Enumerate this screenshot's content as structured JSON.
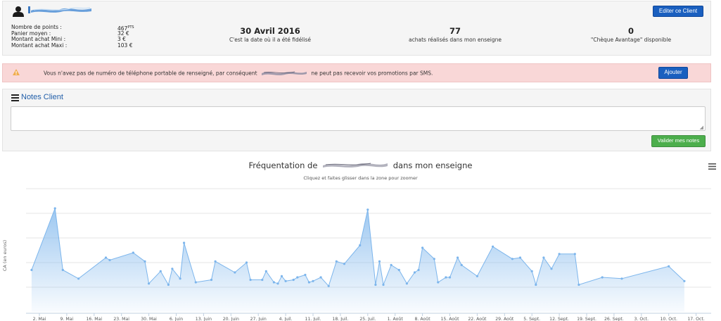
{
  "header": {
    "edit_button": "Editer ce Client",
    "stats": [
      {
        "label": "Nombre de points :",
        "value": "467",
        "unit": "PTS"
      },
      {
        "label": "Panier moyen :",
        "value": "32 €",
        "unit": ""
      },
      {
        "label": "Montant achat Mini :",
        "value": "3 €",
        "unit": ""
      },
      {
        "label": "Montant achat Maxi :",
        "value": "103 €",
        "unit": ""
      }
    ],
    "kpis": {
      "date": {
        "value": "30 Avril 2016",
        "caption": "C'est la date où il a été fidélisé"
      },
      "purchases": {
        "value": "77",
        "caption": "achats réalisés dans mon enseigne"
      },
      "cheque": {
        "value": "0",
        "caption": "\"Chèque Avantage\" disponible"
      }
    }
  },
  "alert": {
    "text_before": "Vous n'avez pas de numéro de téléphone portable de renseigné, par conséquent",
    "text_after": "ne peut pas recevoir vos promotions par SMS.",
    "button": "Ajouter"
  },
  "notes": {
    "title": "Notes Client",
    "value": "",
    "validate_button": "Valider mes notes"
  },
  "chart": {
    "title_before": "Fréquentation de",
    "title_after": "dans mon enseigne",
    "subtitle": "Cliquez et faites glisser dans la zone pour zoomer"
  },
  "chart_data": {
    "type": "area",
    "title": "Fréquentation de … dans mon enseigne",
    "subtitle": "Cliquez et faites glisser dans la zone pour zoomer",
    "xlabel": "",
    "ylabel": "CA (en euros)",
    "grid": true,
    "color": "#7cb5ec",
    "x_tick_labels": [
      "2. Mai",
      "9. Mai",
      "16. Mai",
      "23. Mai",
      "30. Mai",
      "6. Juin",
      "13. Juin",
      "20. Juin",
      "27. Juin",
      "4. Juil.",
      "11. Juil.",
      "18. Juil.",
      "25. Juil.",
      "1. Août",
      "8. Août",
      "15. Août",
      "22. Août",
      "29. Août",
      "5. Sept.",
      "12. Sept.",
      "19. Sept.",
      "26. Sept.",
      "3. Oct.",
      "10. Oct.",
      "17. Oct."
    ],
    "ylim": [
      0,
      5
    ],
    "points": [
      {
        "day": 0,
        "y": 1.7
      },
      {
        "day": 6,
        "y": 4.2
      },
      {
        "day": 8,
        "y": 1.7
      },
      {
        "day": 12,
        "y": 1.35
      },
      {
        "day": 19,
        "y": 2.2
      },
      {
        "day": 20,
        "y": 2.1
      },
      {
        "day": 26,
        "y": 2.4
      },
      {
        "day": 29,
        "y": 2.05
      },
      {
        "day": 30,
        "y": 1.15
      },
      {
        "day": 33,
        "y": 1.65
      },
      {
        "day": 35,
        "y": 1.1
      },
      {
        "day": 36,
        "y": 1.75
      },
      {
        "day": 38,
        "y": 1.35
      },
      {
        "day": 39,
        "y": 2.8
      },
      {
        "day": 42,
        "y": 1.2
      },
      {
        "day": 46,
        "y": 1.3
      },
      {
        "day": 47,
        "y": 2.05
      },
      {
        "day": 52,
        "y": 1.6
      },
      {
        "day": 55,
        "y": 2.0
      },
      {
        "day": 56,
        "y": 1.3
      },
      {
        "day": 59,
        "y": 1.3
      },
      {
        "day": 60,
        "y": 1.65
      },
      {
        "day": 62,
        "y": 1.2
      },
      {
        "day": 63,
        "y": 1.15
      },
      {
        "day": 64,
        "y": 1.45
      },
      {
        "day": 65,
        "y": 1.25
      },
      {
        "day": 67,
        "y": 1.3
      },
      {
        "day": 68,
        "y": 1.4
      },
      {
        "day": 70,
        "y": 1.5
      },
      {
        "day": 71,
        "y": 1.2
      },
      {
        "day": 72,
        "y": 1.25
      },
      {
        "day": 74,
        "y": 1.4
      },
      {
        "day": 76,
        "y": 1.05
      },
      {
        "day": 78,
        "y": 2.05
      },
      {
        "day": 80,
        "y": 1.95
      },
      {
        "day": 84,
        "y": 2.7
      },
      {
        "day": 86,
        "y": 4.15
      },
      {
        "day": 88,
        "y": 1.1
      },
      {
        "day": 89,
        "y": 2.05
      },
      {
        "day": 90,
        "y": 1.1
      },
      {
        "day": 92,
        "y": 1.9
      },
      {
        "day": 94,
        "y": 1.7
      },
      {
        "day": 96,
        "y": 1.15
      },
      {
        "day": 98,
        "y": 1.6
      },
      {
        "day": 99,
        "y": 1.7
      },
      {
        "day": 100,
        "y": 2.6
      },
      {
        "day": 103,
        "y": 2.15
      },
      {
        "day": 104,
        "y": 1.2
      },
      {
        "day": 106,
        "y": 1.4
      },
      {
        "day": 107,
        "y": 1.4
      },
      {
        "day": 109,
        "y": 2.2
      },
      {
        "day": 110,
        "y": 1.9
      },
      {
        "day": 114,
        "y": 1.45
      },
      {
        "day": 118,
        "y": 2.65
      },
      {
        "day": 123,
        "y": 2.15
      },
      {
        "day": 125,
        "y": 2.2
      },
      {
        "day": 128,
        "y": 1.65
      },
      {
        "day": 129,
        "y": 1.1
      },
      {
        "day": 131,
        "y": 2.2
      },
      {
        "day": 133,
        "y": 1.75
      },
      {
        "day": 135,
        "y": 2.35
      },
      {
        "day": 139,
        "y": 2.35
      },
      {
        "day": 140,
        "y": 1.1
      },
      {
        "day": 146,
        "y": 1.4
      },
      {
        "day": 151,
        "y": 1.35
      },
      {
        "day": 163,
        "y": 1.85
      },
      {
        "day": 167,
        "y": 1.25
      }
    ]
  }
}
